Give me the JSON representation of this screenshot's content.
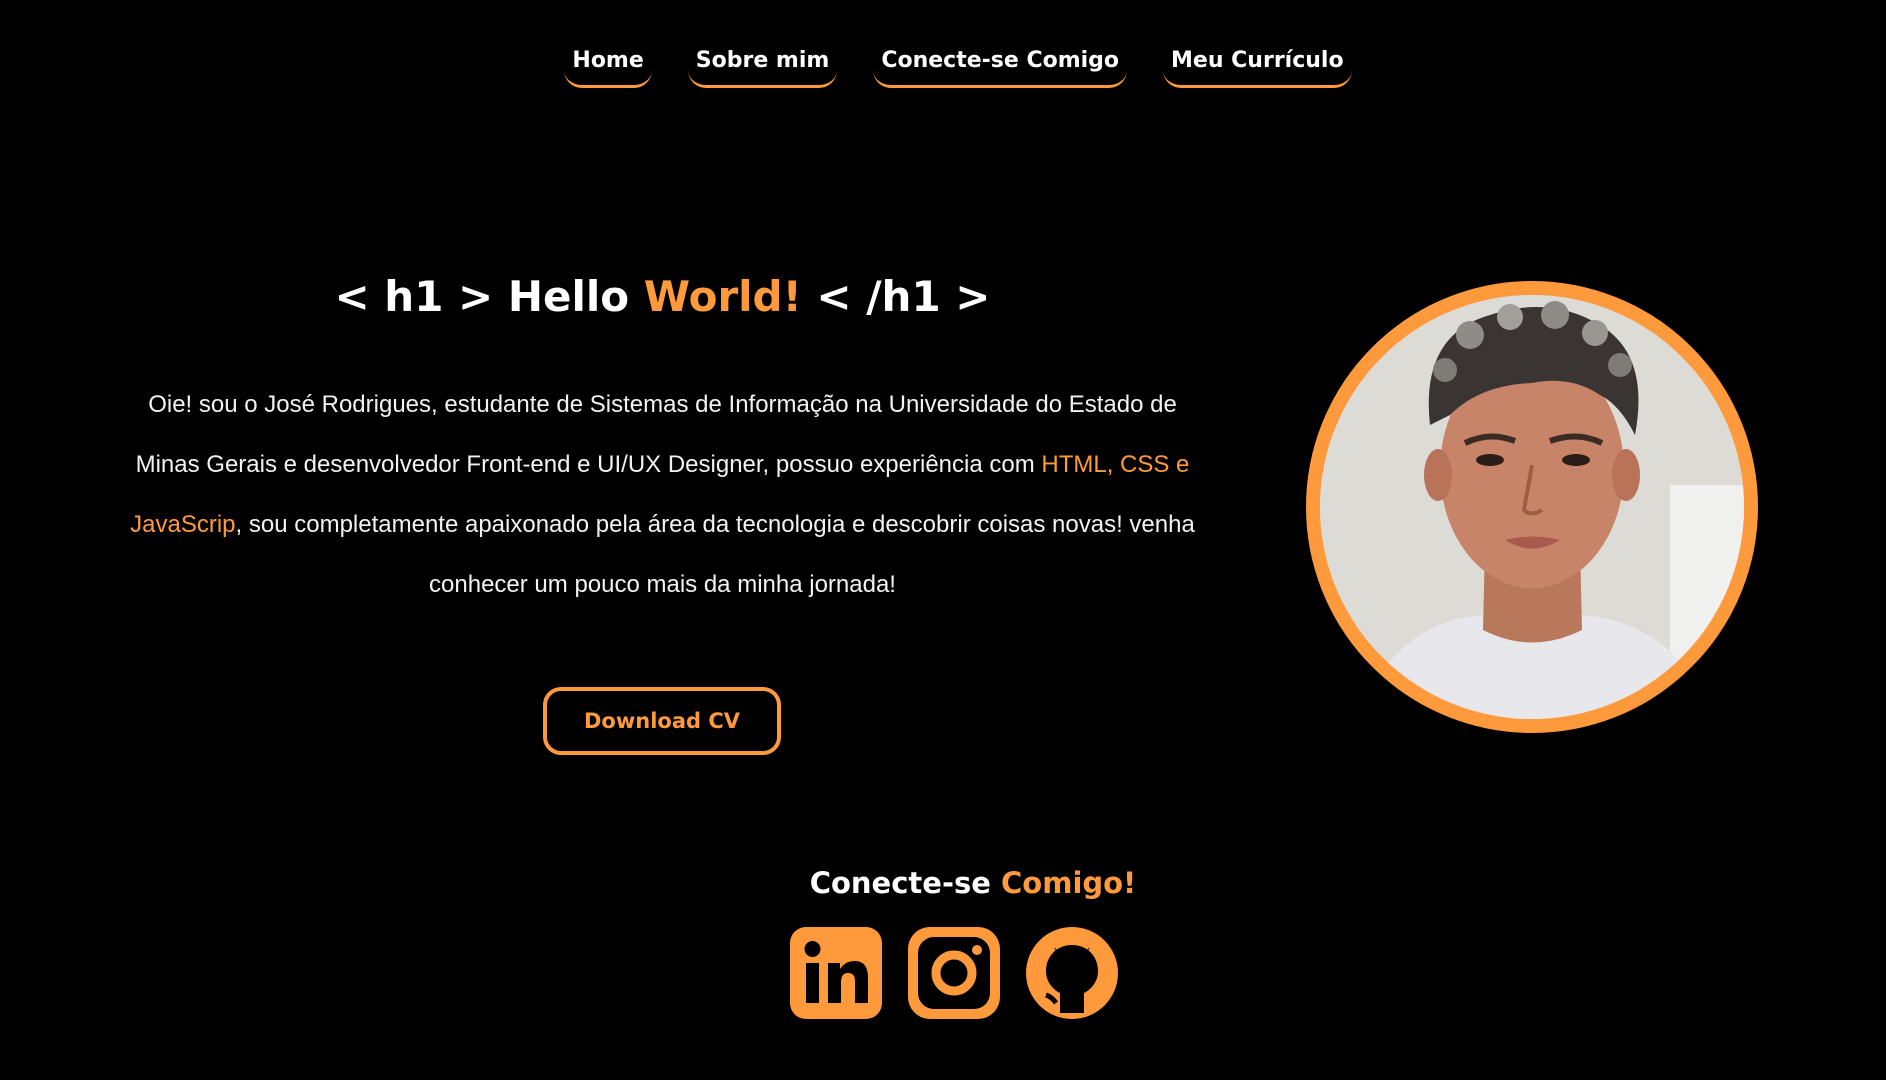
{
  "colors": {
    "background": "#000000",
    "accent": "#ff9a3c",
    "text": "#ffffff"
  },
  "nav": {
    "items": [
      {
        "label": "Home"
      },
      {
        "label": "Sobre mim"
      },
      {
        "label": "Conecte-se Comigo"
      },
      {
        "label": "Meu Currículo"
      }
    ]
  },
  "hero": {
    "title_prefix": "< h1 > Hello ",
    "title_accent": "World!",
    "title_suffix": " < /h1 >",
    "intro_part1": "Oie! sou o José Rodrigues, estudante de Sistemas de Informação na Universidade do Estado de Minas Gerais e desenvolvedor Front-end e UI/UX Designer, possuo experiência com ",
    "intro_accent": "HTML, CSS e JavaScrip",
    "intro_part2": ", sou completamente apaixonado pela área da tecnologia e descobrir coisas novas! venha conhecer um pouco mais da minha jornada!",
    "download_label": "Download CV"
  },
  "connect": {
    "title_prefix": "Conecte-se ",
    "title_accent": "Comigo!",
    "icons": [
      "linkedin-icon",
      "instagram-icon",
      "github-icon"
    ]
  }
}
